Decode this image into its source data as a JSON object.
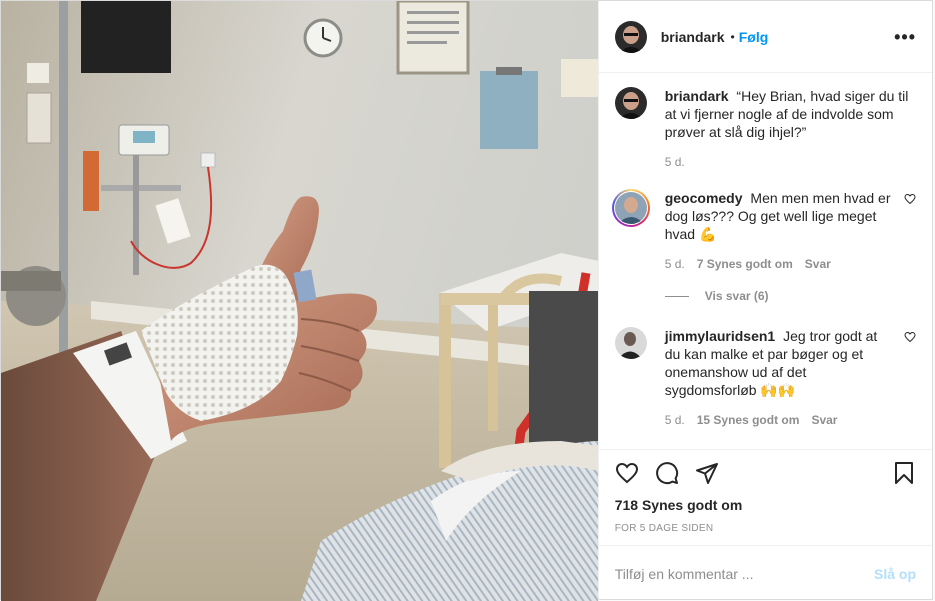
{
  "post": {
    "author": "briandark",
    "follow_dot": "•",
    "follow_label": "Følg",
    "more_label": "•••",
    "caption": {
      "username": "briandark",
      "text": "“Hey Brian, hvad siger du til at vi fjerner nogle af de indvolde som prøver at slå dig ihjel?”",
      "time": "5 d."
    },
    "comments": [
      {
        "username": "geocomedy",
        "text": "Men men men hvad er dog løs??? Og get well lige meget hvad 💪",
        "time": "5 d.",
        "likes": "7 Synes godt om",
        "reply": "Svar",
        "view_replies": "Vis svar (6)"
      },
      {
        "username": "jimmylauridsen1",
        "text": "Jeg tror godt at du kan malke et par bøger og et onemanshow ud af det sygdomsforløb 🙌🙌",
        "time": "5 d.",
        "likes": "15 Synes godt om",
        "reply": "Svar"
      }
    ],
    "like_count": "718 Synes godt om",
    "posted_ago": "FOR 5 DAGE SIDEN",
    "add_comment_placeholder": "Tilføj en kommentar ...",
    "post_button": "Slå op"
  },
  "icons": {
    "like": "heart-icon",
    "comment": "comment-icon",
    "share": "paper-plane-icon",
    "save": "bookmark-icon",
    "comment_like": "heart-icon"
  },
  "colors": {
    "accent": "#0095f6",
    "post_disabled": "#b2dffc",
    "muted": "#8e8e8e",
    "text": "#262626"
  }
}
